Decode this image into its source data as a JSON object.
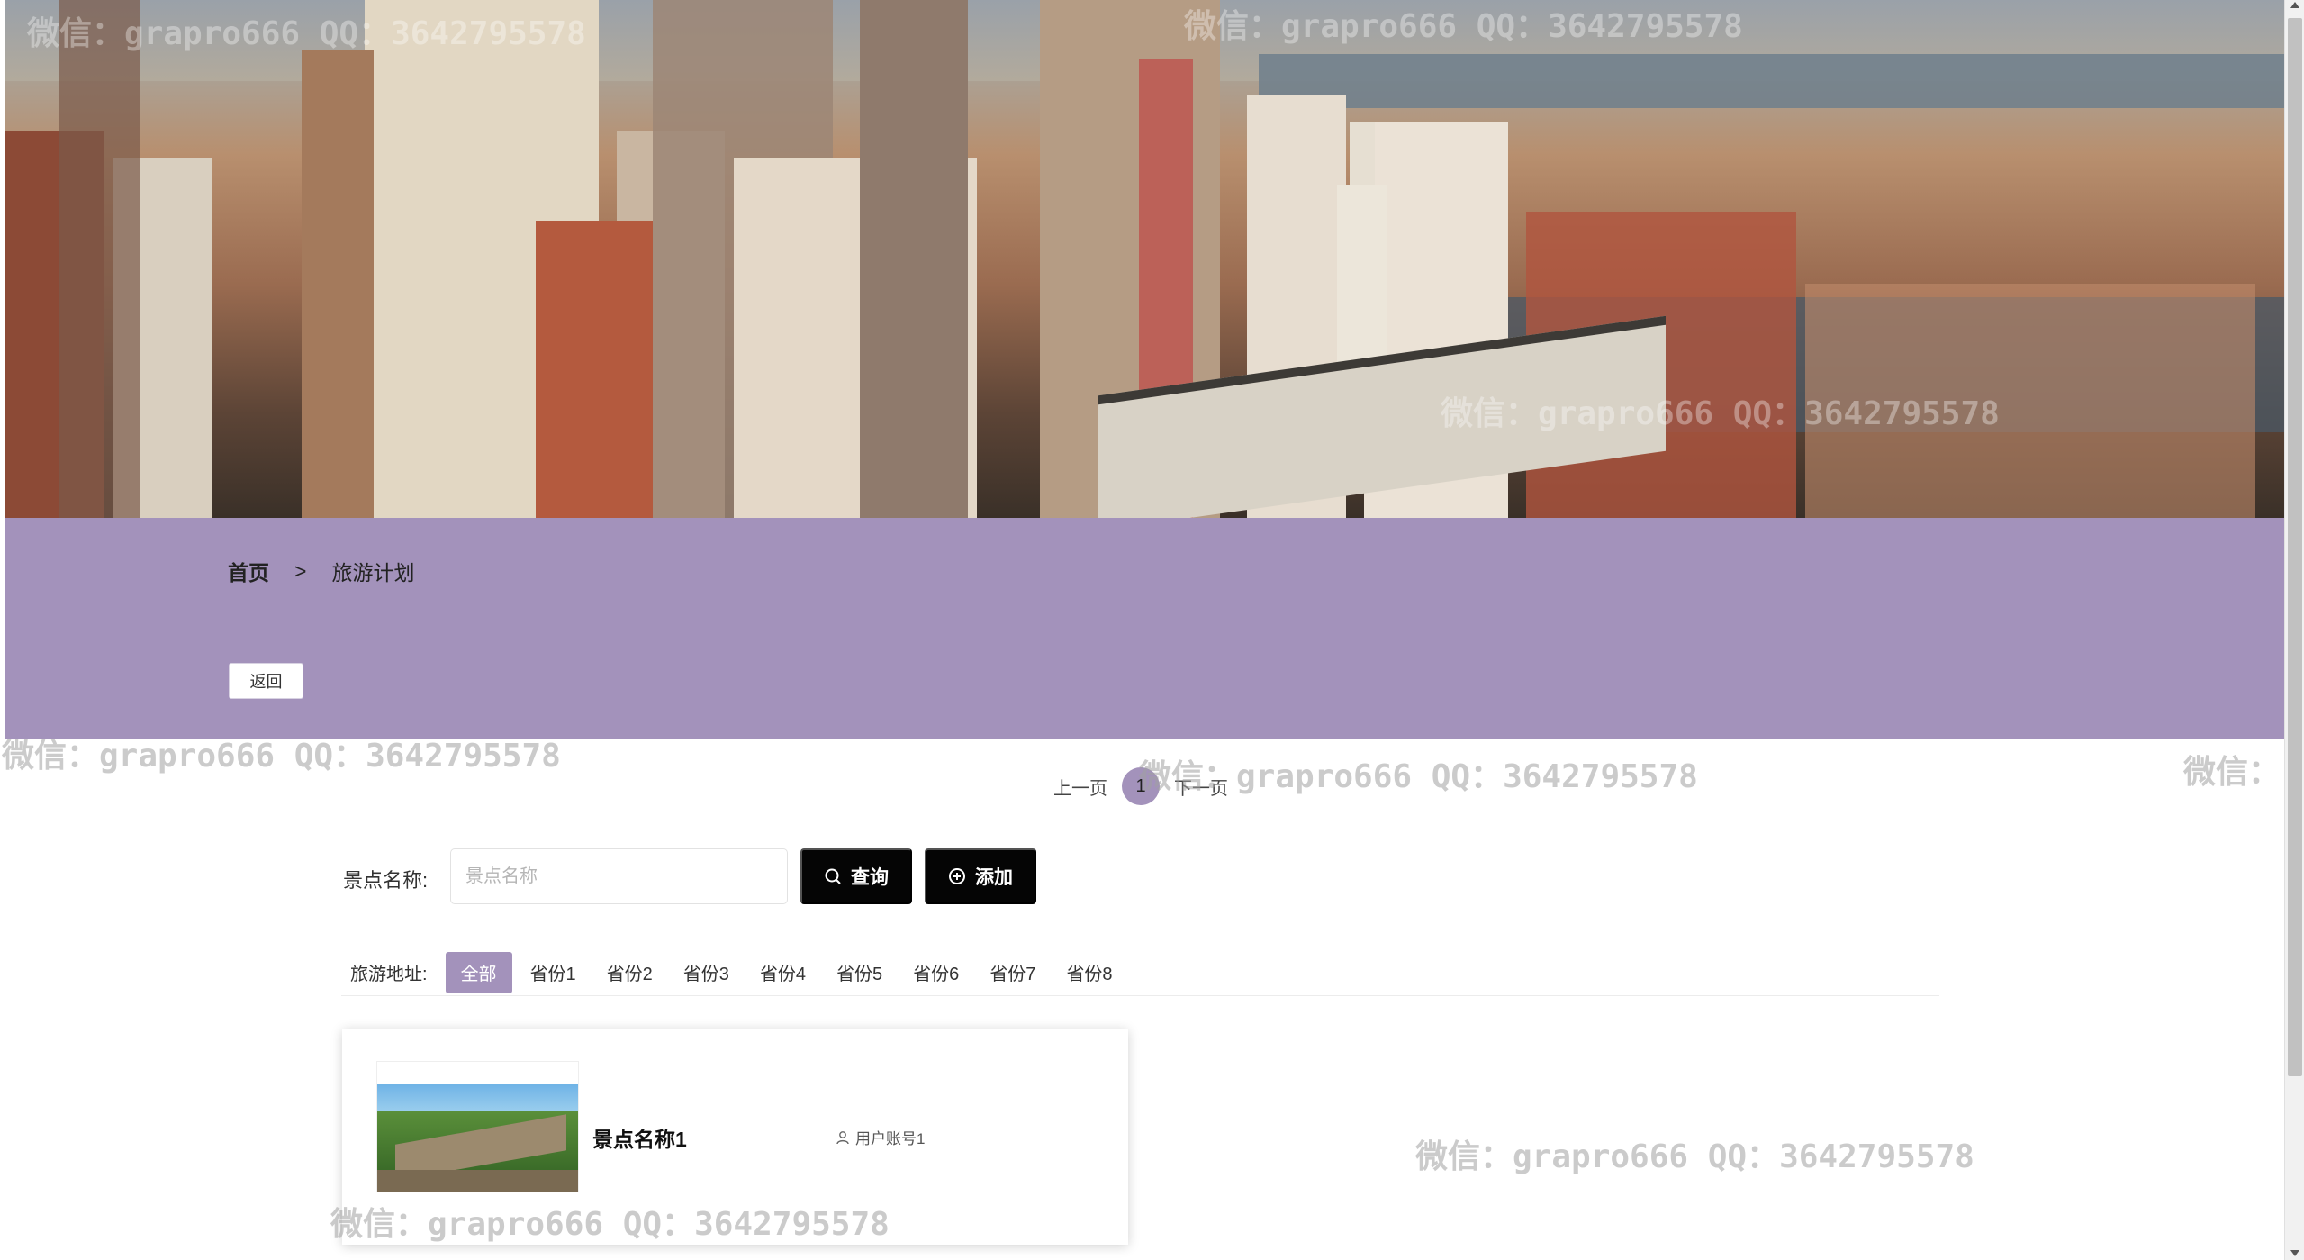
{
  "breadcrumb": {
    "home": "首页",
    "separator": ">",
    "current": "旅游计划"
  },
  "back_button": "返回",
  "pagination": {
    "prev": "上一页",
    "current_page": "1",
    "next": "下一页"
  },
  "search": {
    "label": "景点名称:",
    "placeholder": "景点名称",
    "query_button": "查询",
    "add_button": "添加"
  },
  "filter": {
    "label": "旅游地址:",
    "items": [
      "全部",
      "省份1",
      "省份2",
      "省份3",
      "省份4",
      "省份5",
      "省份6",
      "省份7",
      "省份8"
    ],
    "active": "全部"
  },
  "cards": [
    {
      "name": "景点名称1",
      "user": "用户账号1",
      "image": "great-wall-photo"
    }
  ],
  "watermarks": [
    "微信：grapro666 QQ：3642795578",
    "微信：grapro666 QQ：3642795578",
    "微信：grapro666 QQ：3642795578",
    "微信：grapro666 QQ：3642795578",
    "微信：grapro666 QQ：3642795578",
    "微信：grapro666 QQ：3642795578",
    "微信：grapro666 QQ：3642795578",
    "微信："
  ],
  "colors": {
    "accent": "#a392bb",
    "button_dark": "#050505"
  }
}
